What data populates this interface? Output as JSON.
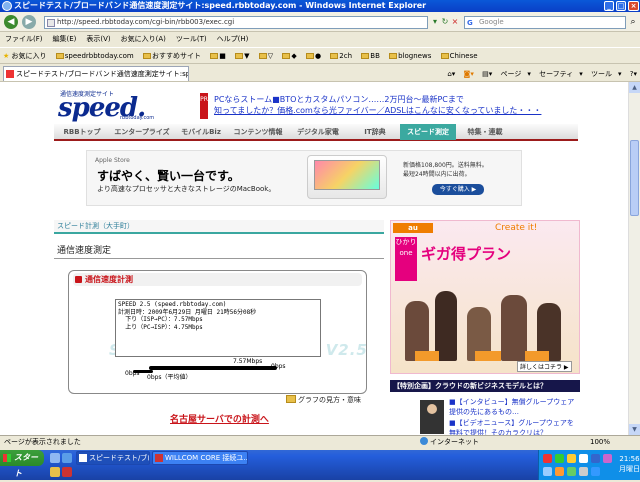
{
  "window": {
    "title": "スピードテスト/ブロードバンド通信速度測定サイト:speed.rbbtoday.com - Windows Internet Explorer",
    "min": "_",
    "max": "□",
    "close": "×"
  },
  "address": {
    "url": "http://speed.rbbtoday.com/cgi-bin/rbb003/exec.cgi",
    "search_placeholder": "Google",
    "back": "◀",
    "forward": "▶",
    "refresh": "↻",
    "stop": "×",
    "go": "▾"
  },
  "menu": [
    "ファイル(F)",
    "編集(E)",
    "表示(V)",
    "お気に入り(A)",
    "ツール(T)",
    "ヘルプ(H)"
  ],
  "favorites": [
    "お気に入り",
    "speedrbbtoday.com",
    "おすすめサイト",
    "■",
    "▼",
    "▽",
    "◆",
    "●",
    "2ch",
    "BB",
    "blognews",
    "Chinese"
  ],
  "tab": {
    "title": "スピードテスト/ブロードバンド通信速度測定サイト:spee..."
  },
  "commands": [
    "ページ",
    "セーフティ",
    "ツール"
  ],
  "site": {
    "logo_sub": "通信速度測定サイト",
    "logo": "speed.",
    "logo_domain": "rbbtoday.com",
    "pr_badge": "PR",
    "pr_line1": "PCならストーム■BTOとカスタムパソコン……2万円台〜最新PCまで",
    "pr_line2": "知ってましたか？価格.comなら光ファイバー／ADSLはこんなに安くなっていました・・・",
    "nav": [
      "RBBトップ",
      "エンタープライズ",
      "モバイルBiz",
      "コンテンツ情報",
      "デジタル家電",
      "IT辞典",
      "スピード測定",
      "特集・連載"
    ],
    "banner": {
      "brand": "Apple Store",
      "headline": "すばやく、賢い一台です。",
      "sub": "より高速なプロセッサと大きなストレージのMacBook。",
      "price1": "新価格108,800円。送料無料。",
      "price2": "最短24時間以内に出荷。",
      "button": "今すぐ購入 ▶"
    },
    "section_breadcrumb": "スピード計測（大手町）",
    "section_title": "通信速度測定",
    "measure": {
      "title": "通信速度計測",
      "result_lines": [
        "SPEED 2.5 (speed.rbbtoday.com)",
        "計測日時：2009年6月29日 月曜日 21時56分08秒",
        "  下り（ISP→PC）：7.57Mbps",
        "  上り（PC→ISP）：4.75Mbps"
      ],
      "watermark": "SPEED RBBTODAY.COM V2.5",
      "gauge_value_label": "7.57Mbps",
      "gauge_end_label": "0bps",
      "gauge_start_label": "0bps",
      "gauge_avg_label": "0bps（平均値）"
    },
    "guide_link": "グラフの見方・意味",
    "nagoya_link": "名古屋サーバでの計測へ",
    "ad": {
      "brand": "au",
      "create": "Create it!",
      "hikari": "ひかりone",
      "title": "ギガ得プラン",
      "more": "詳しくはコチラ ▶"
    },
    "news": {
      "title": "【特別企画】クラウドの新ビジネスモデルとは？",
      "item1_a": "■【インタビュー】無償グループウェア",
      "item1_b": "提供の先にあるもの…",
      "item2_a": "■【ビデオニュース】グループウェアを",
      "item2_b": "無料で提供！そのカラクリは？"
    }
  },
  "status": {
    "text": "ページが表示されました",
    "zone": "インターネット",
    "zoom": "100%"
  },
  "taskbar": {
    "start": "スタート",
    "tasks": [
      "スピードテスト/ブロード...",
      "WILLCOM CORE 接続ユ..."
    ],
    "time": "21:56",
    "day": "月曜日"
  }
}
